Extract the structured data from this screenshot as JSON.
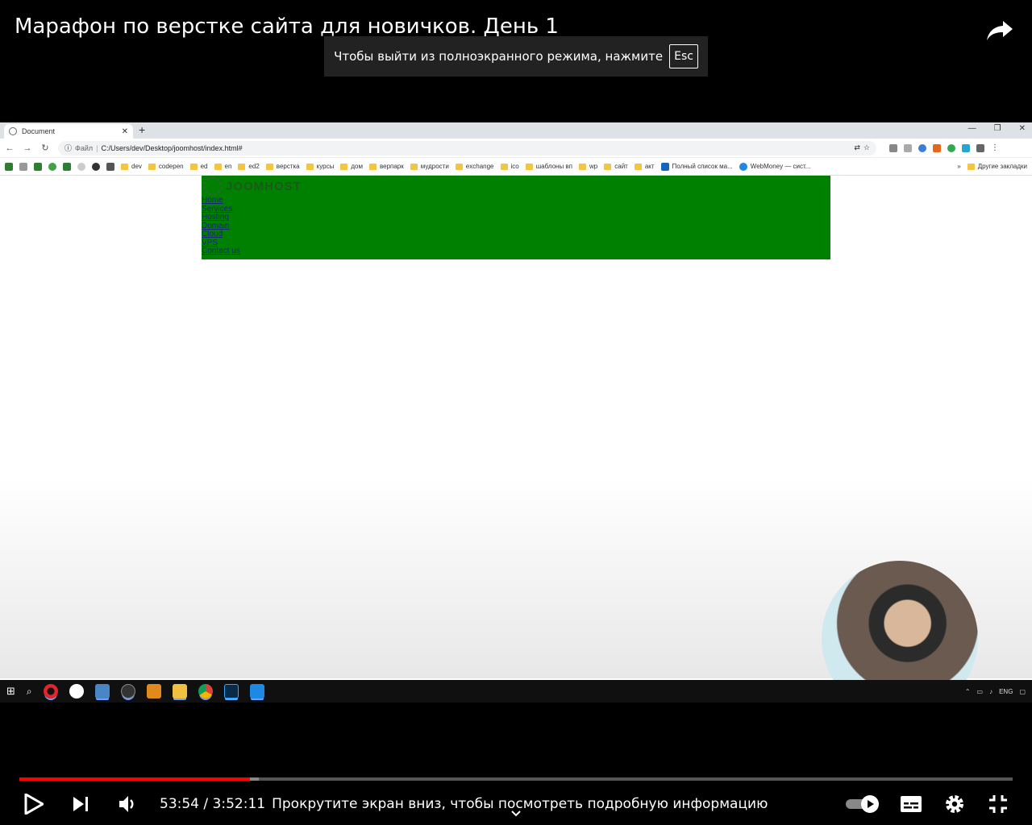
{
  "video": {
    "title": "Марафон по верстке сайта для новичков. День 1",
    "fullscreen_toast": "Чтобы выйти из полноэкранного режима, нажмите",
    "fullscreen_key": "Esc",
    "time_current": "53:54",
    "time_separator": " / ",
    "time_total": "3:52:11",
    "scroll_hint": "Прокрутите экран вниз, чтобы посмотреть подробную информацию",
    "played_fraction": 0.232,
    "loaded_fraction": 0.241,
    "accent": "#ff0000"
  },
  "browser": {
    "tab_title": "Document",
    "omnibox_scheme": "Файл",
    "omnibox_url": "C:/Users/dev/Desktop/joomhost/index.html#",
    "bookmarks": [
      "dev",
      "codepen",
      "ed",
      "en",
      "ed2",
      "верстка",
      "курсы",
      "дом",
      "верпарк",
      "мудрости",
      "exchange",
      "ico",
      "шаблоны вп",
      "wp",
      "сайт",
      "акт"
    ],
    "bookmark_extra_1": "Полный список ма...",
    "bookmark_extra_2": "WebMoney — сист...",
    "other_bookmarks": "Другие закладки",
    "overflow": "»"
  },
  "site": {
    "logo_text": "JOOMHOST",
    "header_bg": "#008000",
    "menu": [
      "Home",
      "Services",
      "Hosting",
      "Domain",
      "Cloud",
      "VPS",
      "Contact us"
    ]
  },
  "taskbar": {
    "lang": "ENG"
  }
}
